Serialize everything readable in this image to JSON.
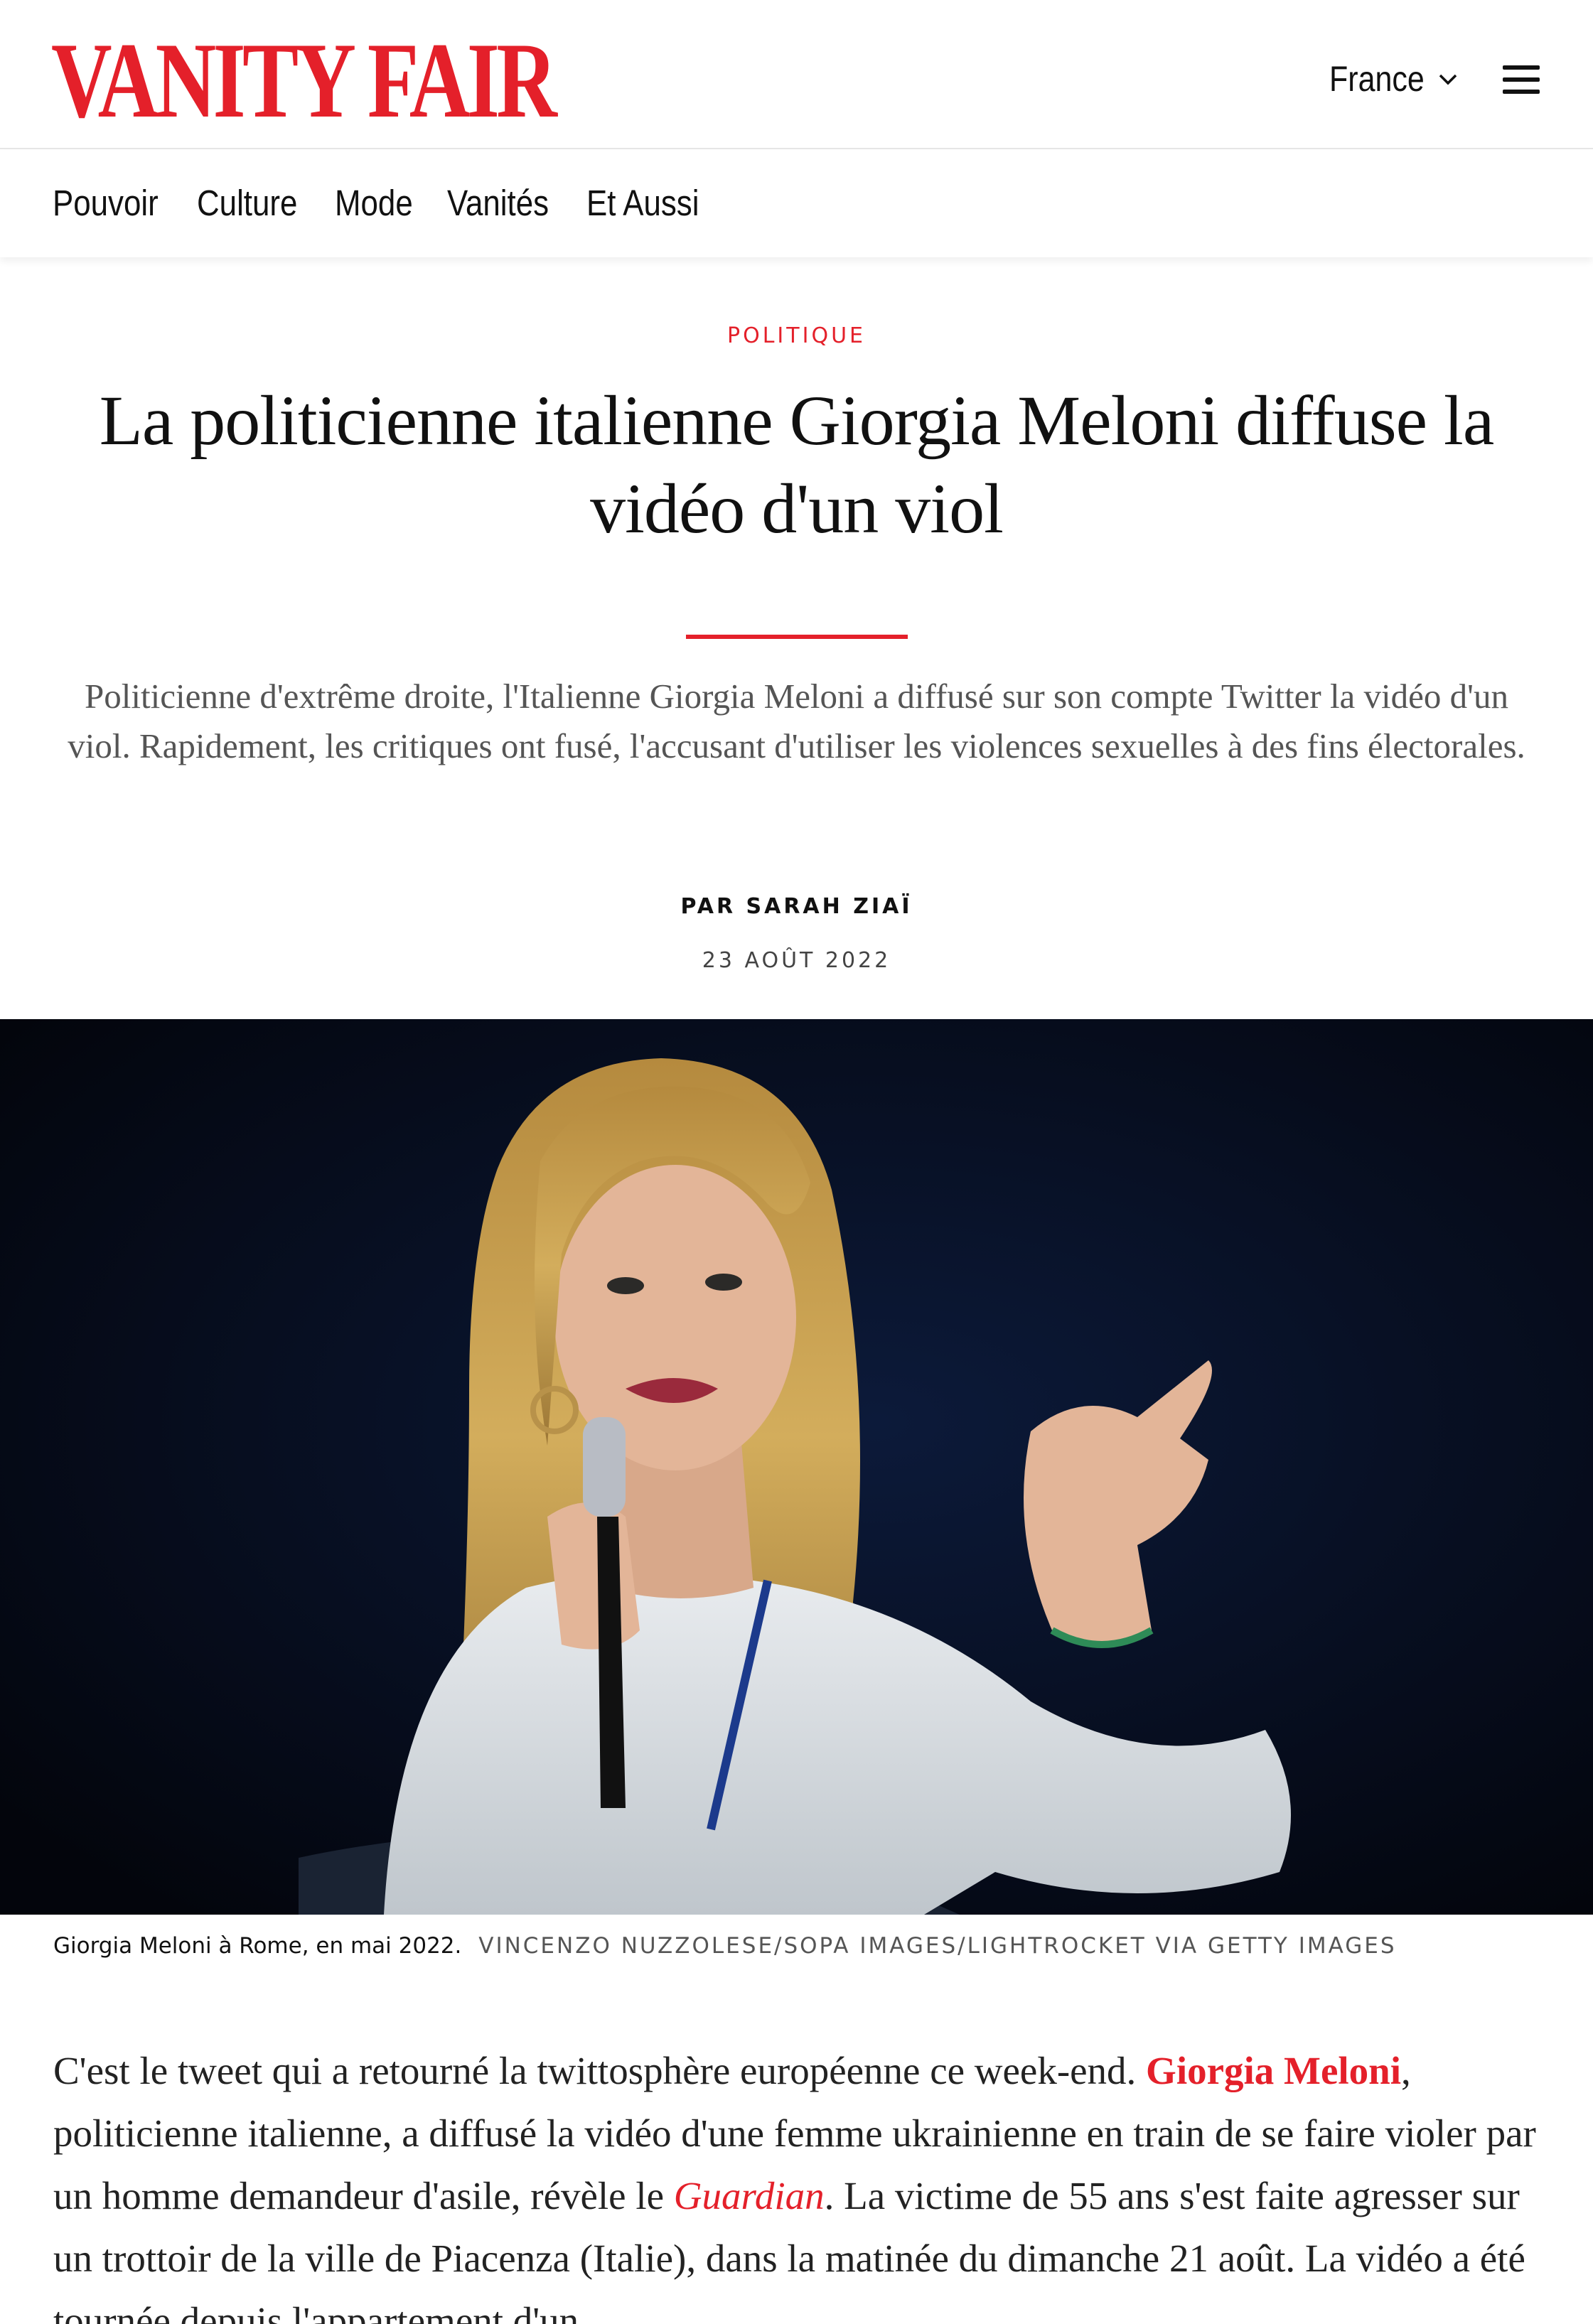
{
  "header": {
    "logo": "VANITY FAIR",
    "edition": "France",
    "menu_icon": "hamburger-menu-icon"
  },
  "nav": {
    "items": [
      "Pouvoir",
      "Culture",
      "Mode",
      "Vanités",
      "Et Aussi"
    ]
  },
  "article": {
    "rubric": "POLITIQUE",
    "headline": "La politicienne italienne Giorgia Meloni diffuse la vidéo d'un viol",
    "dek": "Politicienne d'extrême droite, l'Italienne Giorgia Meloni a diffusé sur son compte Twitter la vidéo d'un viol. Rapidement, les critiques ont fusé, l'accusant d'utiliser les violences sexuelles à des fins électorales.",
    "byline": "PAR SARAH ZIAÏ",
    "date": "23 AOÛT 2022",
    "caption": "Giorgia Meloni à Rome, en mai 2022.",
    "credit": "VINCENZO NUZZOLESE/SOPA IMAGES/LIGHTROCKET VIA GETTY IMAGES",
    "body": {
      "p1_part1": "C'est le tweet qui a retourné la twittosphère européenne ce week-end. ",
      "link_meloni": "Giorgia Meloni",
      "p1_part2": ", politicienne italienne, a diffusé la vidéo d'une femme ukrainienne en train de se faire violer par un homme demandeur d'asile, révèle le ",
      "link_guardian": "Guardian",
      "p1_part3": ". La victime de 55 ans s'est faite agresser sur un trottoir de la ville de Piacenza (Italie), dans la matinée du dimanche 21 août. La vidéo a été tournée depuis l'appartement d'un"
    }
  },
  "colors": {
    "accent": "#e4202a",
    "text": "#111111",
    "muted": "#555555",
    "image_background": "#050813"
  }
}
